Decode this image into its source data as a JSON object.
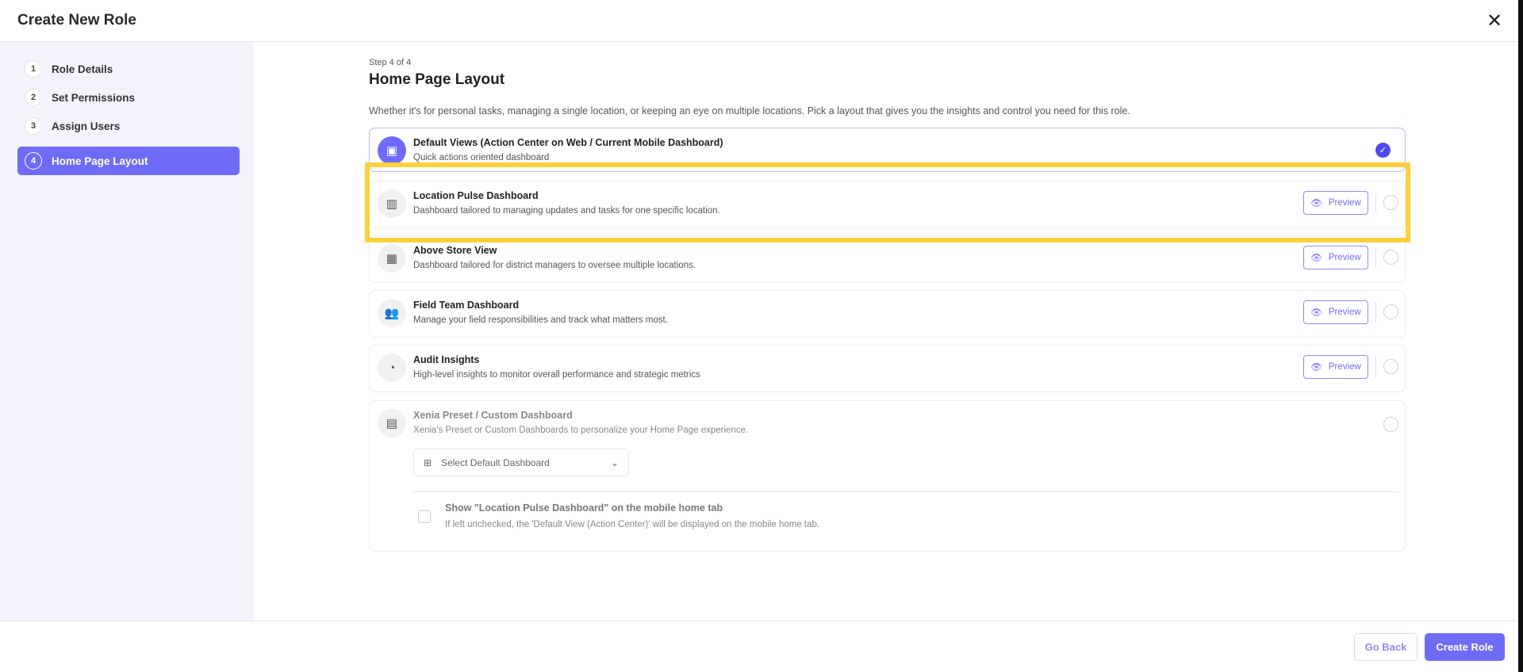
{
  "header": {
    "title": "Create New Role",
    "close_icon": "close-icon"
  },
  "sidebar": {
    "steps": [
      {
        "num": "1",
        "label": "Role Details"
      },
      {
        "num": "2",
        "label": "Set Permissions"
      },
      {
        "num": "3",
        "label": "Assign Users"
      },
      {
        "num": "4",
        "label": "Home Page Layout",
        "active": true
      }
    ]
  },
  "main": {
    "step_label": "Step 4 of 4",
    "title": "Home Page Layout",
    "description": "Whether it's for personal tasks, managing a single location, or keeping an eye on multiple locations. Pick a layout that gives you the insights and control you need for this role.",
    "options": [
      {
        "title": "Default Views (Action Center on Web / Current Mobile Dashboard)",
        "desc": "Quick actions oriented dashboard",
        "icon": "presentation-icon",
        "selected": true
      },
      {
        "title": "Location Pulse Dashboard",
        "desc": "Dashboard tailored to managing updates and tasks for one specific location.",
        "icon": "building-icon",
        "preview": "Preview"
      },
      {
        "title": "Above Store View",
        "desc": "Dashboard tailored for district managers to oversee multiple locations.",
        "icon": "grid-icon",
        "preview": "Preview"
      },
      {
        "title": "Field Team Dashboard",
        "desc": "Manage your field responsibilities and track what matters most.",
        "icon": "team-icon",
        "preview": "Preview"
      },
      {
        "title": "Audit Insights",
        "desc": "High-level insights to monitor overall performance and strategic metrics",
        "icon": "gauge-icon",
        "preview": "Preview"
      },
      {
        "title": "Xenia Preset / Custom Dashboard",
        "desc": "Xenia's Preset or Custom Dashboards to personalize your Home Page experience.",
        "icon": "chart-icon",
        "dropdown_placeholder": "Select Default Dashboard",
        "checkbox_label": "Show \"Location Pulse Dashboard\" on the mobile home tab",
        "checkbox_desc": "If left unchecked, the 'Default View (Action Center)' will be displayed on the mobile home tab.",
        "checked": false
      }
    ]
  },
  "footer": {
    "back": "Go Back",
    "create": "Create Role"
  },
  "colors": {
    "accent": "#6e6cf7",
    "highlight": "#fdd03d"
  }
}
